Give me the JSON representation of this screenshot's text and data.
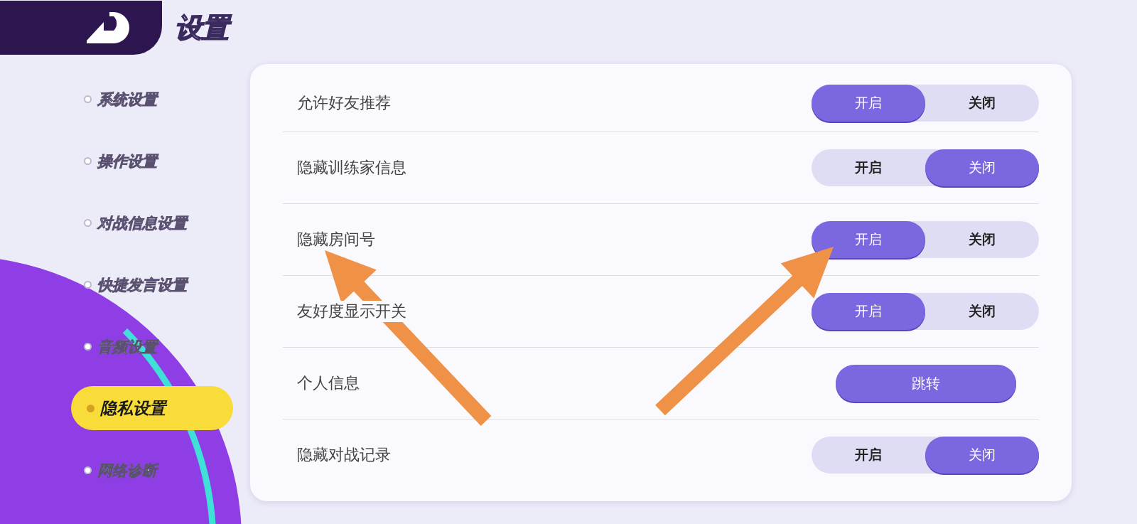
{
  "header": {
    "title": "设置"
  },
  "sidebar": {
    "items": [
      {
        "label": "系统设置",
        "selected": false
      },
      {
        "label": "操作设置",
        "selected": false
      },
      {
        "label": "对战信息设置",
        "selected": false
      },
      {
        "label": "快捷发言设置",
        "selected": false
      },
      {
        "label": "音频设置",
        "selected": false
      },
      {
        "label": "隐私设置",
        "selected": true
      },
      {
        "label": "网络诊断",
        "selected": false
      }
    ]
  },
  "settings": [
    {
      "kind": "toggle",
      "label": "允许好友推荐",
      "options": [
        {
          "label": "开启",
          "selected": true
        },
        {
          "label": "关闭",
          "selected": false
        }
      ]
    },
    {
      "kind": "toggle",
      "label": "隐藏训练家信息",
      "options": [
        {
          "label": "开启",
          "selected": false
        },
        {
          "label": "关闭",
          "selected": true
        }
      ]
    },
    {
      "kind": "toggle",
      "label": "隐藏房间号",
      "options": [
        {
          "label": "开启",
          "selected": true
        },
        {
          "label": "关闭",
          "selected": false
        }
      ]
    },
    {
      "kind": "toggle",
      "label": "友好度显示开关",
      "options": [
        {
          "label": "开启",
          "selected": true
        },
        {
          "label": "关闭",
          "selected": false
        }
      ]
    },
    {
      "kind": "button",
      "label": "个人信息",
      "button": "跳转"
    },
    {
      "kind": "toggle",
      "label": "隐藏对战记录",
      "options": [
        {
          "label": "开启",
          "selected": false
        },
        {
          "label": "关闭",
          "selected": true
        }
      ]
    }
  ]
}
